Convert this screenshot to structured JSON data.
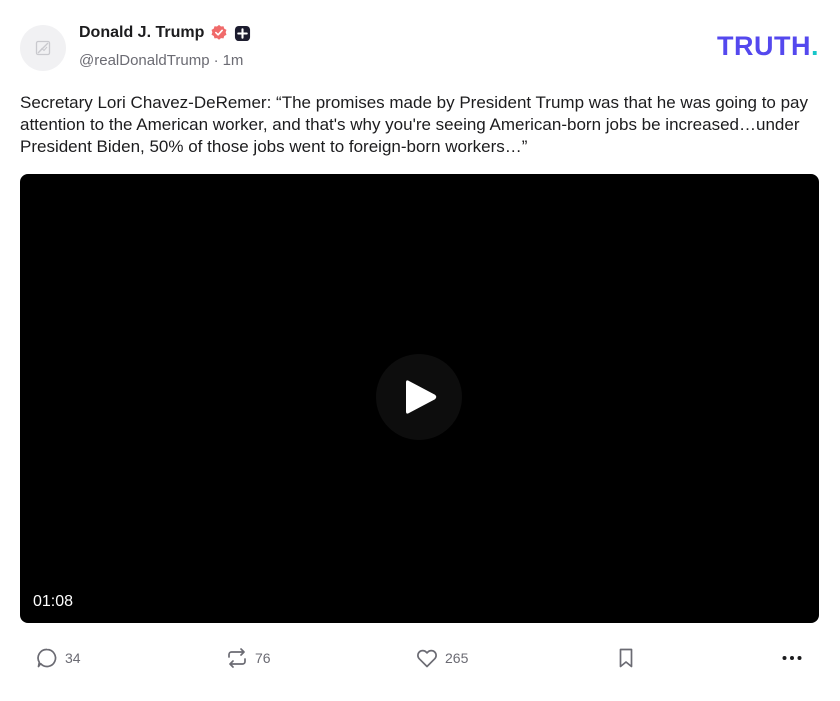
{
  "post": {
    "author_name": "Donald J. Trump",
    "handle": "@realDonaldTrump",
    "separator": "·",
    "time": "1m",
    "text": "Secretary Lori Chavez-DeRemer: “The promises made by President Trump was that he was going to pay attention to the American worker, and that's why you're seeing American-born jobs be increased…under President Biden, 50% of those jobs went to foreign-born workers…”"
  },
  "brand": {
    "logo_text": "TRUTH",
    "logo_dot": ".",
    "colors": {
      "logo": "#5448ee",
      "logo_dot": "#17c6c9",
      "verified": "#f06a6a"
    }
  },
  "video": {
    "duration": "01:08"
  },
  "actions": {
    "replies": "34",
    "retruths": "76",
    "likes": "265"
  },
  "icons": [
    "image-placeholder-icon",
    "verified-badge-icon",
    "plus-badge-icon",
    "play-icon",
    "reply-icon",
    "retruth-icon",
    "like-icon",
    "bookmark-icon",
    "more-icon"
  ]
}
